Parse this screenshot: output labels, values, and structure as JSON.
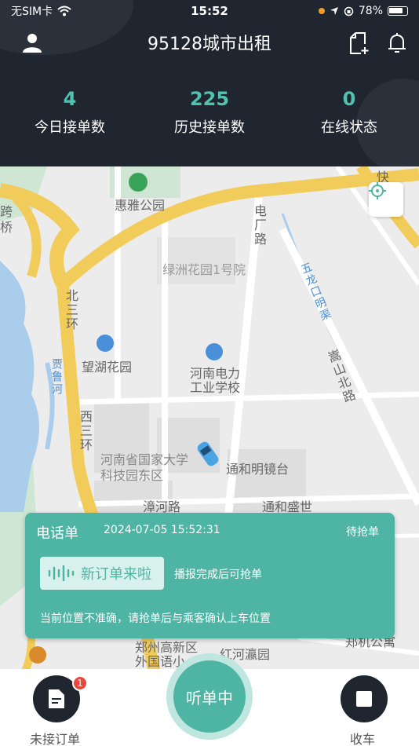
{
  "status_bar": {
    "carrier": "无SIM卡",
    "time": "15:52",
    "battery": "78%"
  },
  "header": {
    "title": "95128城市出租",
    "stats": [
      {
        "value": "4",
        "label": "今日接单数"
      },
      {
        "value": "225",
        "label": "历史接单数"
      },
      {
        "value": "0",
        "label": "在线状态"
      }
    ]
  },
  "map": {
    "labels": {
      "park": "惠雅公园",
      "garden1": "绿洲花园1号院",
      "road_dianchang": "电厂路",
      "river_wulong": "五龙口明渠",
      "beisanhuan": "北三环",
      "jialuhe": "贾鲁河",
      "wanghu": "望湖花园",
      "school": "河南电力工业学校",
      "songshan": "嵩山北路",
      "xisanhuan": "西三环",
      "sciencepark": "河南省国家大学科技园东区",
      "tonghe_mirror": "通和明镜台",
      "zhanghe": "漳河路",
      "tonghe_shengshi": "通和盛世",
      "zhengzhou_school": "郑州高新区外国语小",
      "hongheyuan": "红河瀛园",
      "kua": "跨",
      "qiao": "桥",
      "kuai": "快",
      "zhengji": "郑机公寓"
    }
  },
  "order_card": {
    "type": "电话单",
    "datetime": "2024-07-05 15:52:31",
    "status": "待抢单",
    "new_order_text": "新订单来啦",
    "hint": "播报完成后可抢单",
    "note": "当前位置不准确，请抢单后与乘客确认上车位置"
  },
  "bottom": {
    "pending_label": "未接订单",
    "pending_count": "1",
    "listen_label": "听单中",
    "close_label": "收车"
  }
}
